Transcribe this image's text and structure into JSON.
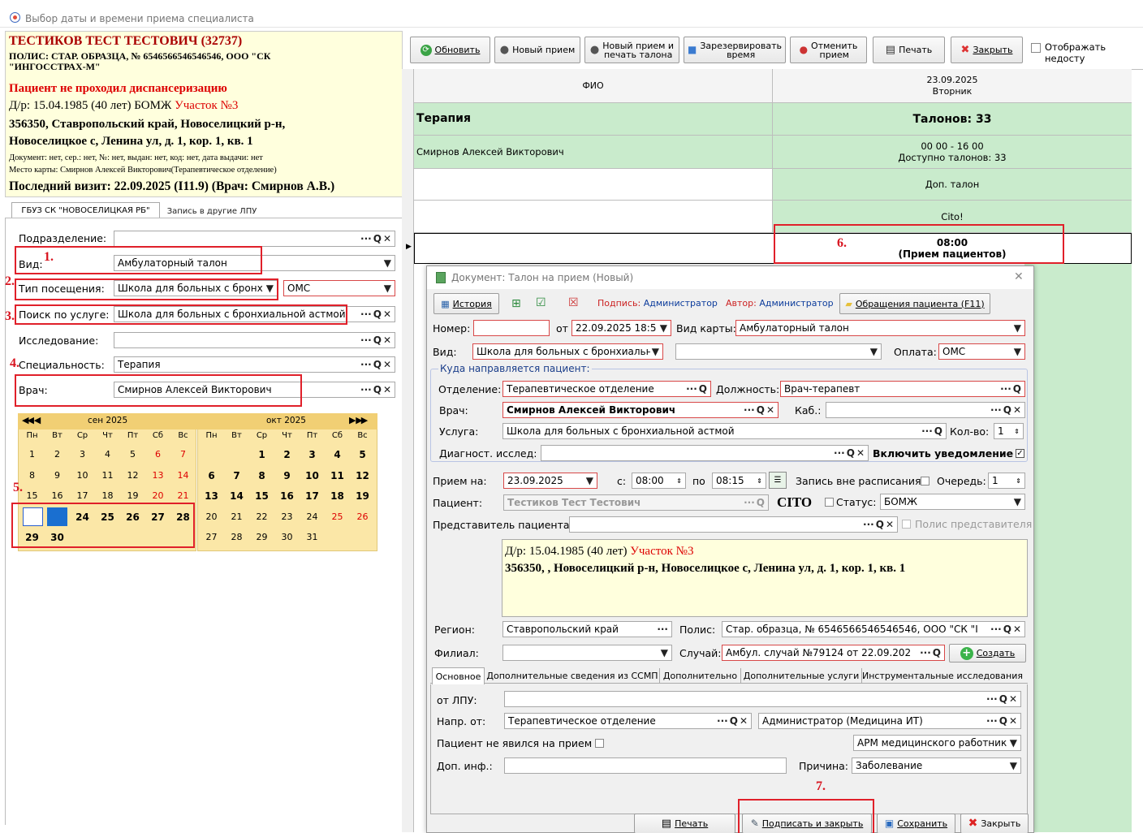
{
  "window": {
    "title": "Выбор даты и времени приема специалиста"
  },
  "patient": {
    "name": "ТЕСТИКОВ ТЕСТ ТЕСТОВИЧ (32737)",
    "policy_line1": "ПОЛИС: СТАР. ОБРАЗЦА, № 6546566546546546, ООО \"СК",
    "policy_line2": "\"ИНГОССТРАХ-М\"",
    "warning": "Пациент не проходил диспансеризацию",
    "dob": "Д/р: 15.04.1985 (40 лет) БОМЖ ",
    "district": "Участок №3",
    "address1": "356350, Ставропольский край, Новоселицкий р-н,",
    "address2": "Новоселицкое с, Ленина ул, д. 1, кор. 1, кв. 1",
    "document": "Документ: нет, сер.: нет, №: нет, выдан: нет, код: нет, дата выдачи: нет",
    "card_place": "Место карты: Смирнов Алексей Викторович(Терапевтическое отделение)",
    "last_visit": "Последний визит: 22.09.2025 (I11.9) (Врач: Смирнов А.В.)"
  },
  "left_tabs": [
    "ГБУЗ СК \"НОВОСЕЛИЦКАЯ РБ\"",
    "Запись в другие ЛПУ"
  ],
  "filters": {
    "division_label": "Подразделение:",
    "division_value": "",
    "type_label": "Вид:",
    "type_value": "Амбулаторный талон",
    "visit_label": "Тип посещения:",
    "visit_value": "Школа для больных с бронх",
    "visit_pay": "ОМС",
    "service_label": "Поиск по услуге:",
    "service_value": "Школа для больных с бронхиальной астмой",
    "research_label": "Исследование:",
    "research_value": "",
    "specialty_label": "Специальность:",
    "specialty_value": "Терапия",
    "doctor_label": "Врач:",
    "doctor_value": "Смирнов Алексей Викторович"
  },
  "markers": [
    "1.",
    "2.",
    "3.",
    "4.",
    "5.",
    "6.",
    "7."
  ],
  "calendar": {
    "weekdays": [
      "Пн",
      "Вт",
      "Ср",
      "Чт",
      "Пт",
      "Сб",
      "Вс"
    ],
    "nav_prev": "◀◀ ◀",
    "nav_next": "▶ ▶▶",
    "sep": {
      "title": "сен 2025",
      "rows": [
        [
          "1",
          "2",
          "3",
          "4",
          "5",
          "6",
          "7"
        ],
        [
          "8",
          "9",
          "10",
          "11",
          "12",
          "13",
          "14"
        ],
        [
          "15",
          "16",
          "17",
          "18",
          "19",
          "20",
          "21"
        ],
        [
          "22",
          "23",
          "24",
          "25",
          "26",
          "27",
          "28"
        ],
        [
          "29",
          "30",
          "",
          "",
          "",
          "",
          ""
        ]
      ]
    },
    "oct": {
      "title": "окт 2025",
      "rows": [
        [
          "",
          "",
          "1",
          "2",
          "3",
          "4",
          "5"
        ],
        [
          "6",
          "7",
          "8",
          "9",
          "10",
          "11",
          "12"
        ],
        [
          "13",
          "14",
          "15",
          "16",
          "17",
          "18",
          "19"
        ],
        [
          "20",
          "21",
          "22",
          "23",
          "24",
          "25",
          "26"
        ],
        [
          "27",
          "28",
          "29",
          "30",
          "31",
          "",
          ""
        ]
      ]
    }
  },
  "toolbar": {
    "refresh": "Обновить",
    "new": "Новый прием",
    "new_print_1": "Новый прием и",
    "new_print_2": "печать талона",
    "reserve_1": "Зарезервировать",
    "reserve_2": "время",
    "cancel_1": "Отменить",
    "cancel_2": "прием",
    "print": "Печать",
    "close": "Закрыть",
    "show_unavailable": "Отображать недосту"
  },
  "grid": {
    "col_fio": "ФИО",
    "date": "23.09.2025",
    "weekday": "Вторник",
    "specialty": "Терапия",
    "tickets": "Талонов: 33",
    "doctor": "Смирнов Алексей Викторович",
    "hours": "00 00 - 16 00",
    "available": "Доступно талонов: 33",
    "extra": "Доп. талон",
    "cito": "Cito!",
    "slot_time": "08:00",
    "slot_label": "(Прием пациентов)"
  },
  "dialog": {
    "title": "Документ: Талон на прием (Новый)",
    "history": "История",
    "sign_label": "Подпись:",
    "sign_value": "Администратор",
    "author_label": "Автор:",
    "author_value": "Администратор",
    "appeals": "Обращения пациента (F11)",
    "number_label": "Номер:",
    "number_value": "",
    "from_label": "от",
    "from_value": "22.09.2025 18:5",
    "card_type_label": "Вид карты:",
    "card_type_value": "Амбулаторный талон",
    "kind_label": "Вид:",
    "kind_value": "Школа для больных с бронхиальн",
    "kind2_value": "",
    "pay_label": "Оплата:",
    "pay_value": "ОМС",
    "direct_group": "Куда направляется пациент:",
    "dept_label": "Отделение:",
    "dept_value": "Терапевтическое отделение",
    "position_label": "Должность:",
    "position_value": "Врач-терапевт",
    "doctor_label": "Врач:",
    "doctor_value": "Смирнов Алексей Викторович",
    "room_label": "Каб.:",
    "room_value": "",
    "service_label": "Услуга:",
    "service_value": "Школа для больных с бронхиальной астмой",
    "qty_label": "Кол-во:",
    "qty_value": "1",
    "diag_label": "Диагност. исслед:",
    "diag_value": "",
    "notify_label": "Включить уведомление",
    "date_label": "Прием на:",
    "date_value": "23.09.2025",
    "from_t_label": "с:",
    "from_t": "08:00",
    "to_t_label": "по",
    "to_t": "08:15",
    "offsched_label": "Запись вне расписания",
    "queue_label": "Очередь:",
    "queue_value": "1",
    "patient_label": "Пациент:",
    "patient_value": "Тестиков Тест Тестович",
    "cito": "CITO",
    "status_label": "Статус:",
    "status_value": "БОМЖ",
    "rep_label": "Представитель пациента:",
    "rep_value": "",
    "rep_policy": "Полис представителя",
    "info_dob": "Д/р: 15.04.1985 (40 лет) ",
    "info_district": "Участок №3",
    "info_address": "356350, , Новоселицкий р-н, Новоселицкое с, Ленина ул, д. 1, кор. 1, кв. 1",
    "region_label": "Регион:",
    "region_value": "Ставропольский край",
    "policy_label": "Полис:",
    "policy_value": "Стар. образца, № 6546566546546546, ООО \"СК \"I",
    "branch_label": "Филиал:",
    "branch_value": "",
    "case_label": "Случай:",
    "case_value": "Амбул. случай №79124 от 22.09.202",
    "create": "Создать",
    "tabs": [
      "Основное",
      "Дополнительные сведения из ССМП",
      "Дополнительно",
      "Дополнительные услуги",
      "Инструментальные исследования"
    ],
    "lpu_label": "от ЛПУ:",
    "lpu_value": "",
    "ref_label": "Напр. от:",
    "ref_value": "Терапевтическое отделение",
    "ref_value2": "Администратор (Медицина ИТ)",
    "noshow_label": "Пациент не явился на прием",
    "arm_value": "АРМ медицинского работник",
    "extra_label": "Доп. инф.:",
    "extra_value": "",
    "reason_label": "Причина:",
    "reason_value": "Заболевание",
    "print": "Печать",
    "sign_close": "Подписать и закрыть",
    "save": "Сохранить",
    "close": "Закрыть"
  },
  "colors": {
    "accent_red": "#e0202a",
    "grid_green": "#c9ebcc",
    "patient_bg": "#ffffdd",
    "calendar_bg": "#fbe7a7"
  }
}
